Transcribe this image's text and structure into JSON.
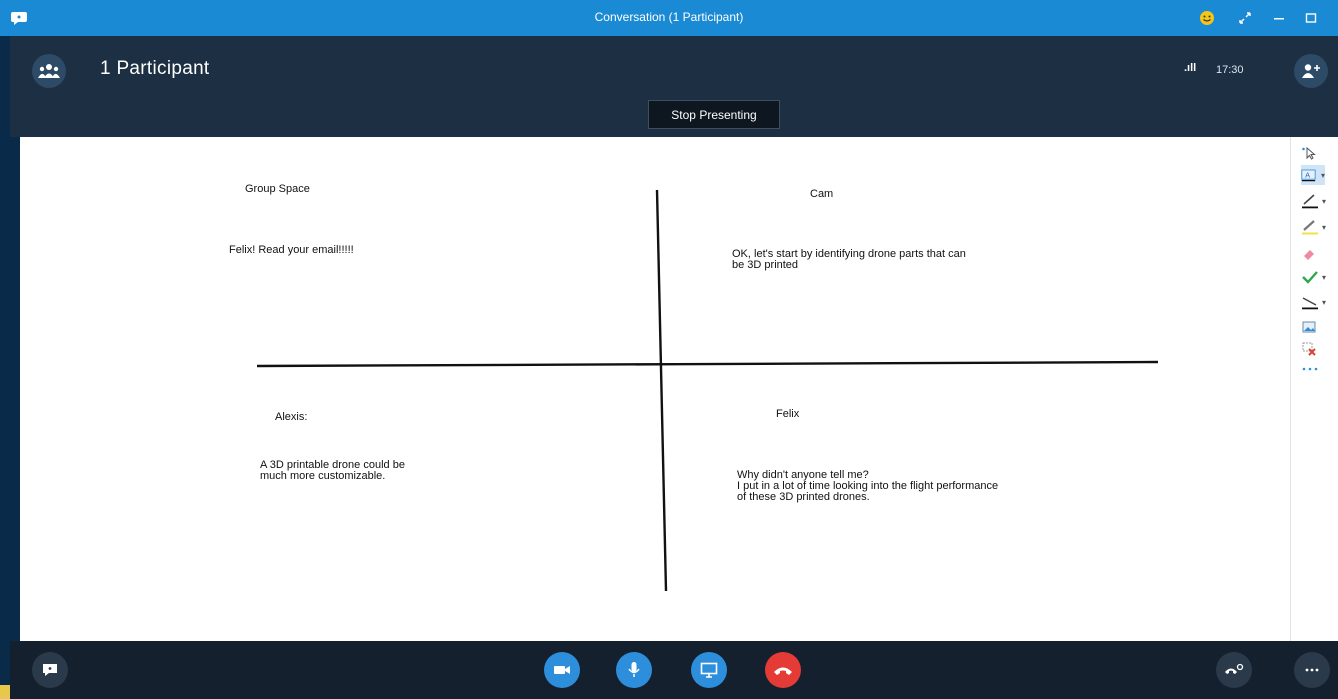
{
  "window": {
    "title": "Conversation (1 Participant)",
    "controls": [
      "emoji-icon",
      "expand-icon",
      "minimize-icon",
      "maximize-icon"
    ]
  },
  "header": {
    "participants_label": "1 Participant",
    "signal": ".ıll",
    "time": "17:30",
    "stop_presenting_label": "Stop Presenting"
  },
  "whiteboard": {
    "quadrants": {
      "top_left": {
        "heading": "Group Space",
        "body": "Felix!  Read your email!!!!!"
      },
      "top_right": {
        "heading": "Cam",
        "body": "OK, let's start by identifying drone parts that can\nbe 3D printed"
      },
      "bottom_left": {
        "heading": "Alexis:",
        "body": "A 3D printable drone could be\nmuch more customizable."
      },
      "bottom_right": {
        "heading": "Felix",
        "body": "Why didn't anyone tell me?\nI put in a lot of time looking into the flight performance\nof these 3D printed drones."
      }
    },
    "tools": [
      "pointer-icon",
      "text-tool-icon",
      "pen-icon",
      "highlighter-icon",
      "eraser-icon",
      "stamp-icon",
      "shape-icon",
      "insert-image-icon",
      "delete-selection-icon",
      "more-options-icon"
    ]
  },
  "bottom_bar": {
    "buttons": [
      "chat-icon",
      "video-icon",
      "microphone-icon",
      "present-screen-icon",
      "hang-up-icon",
      "call-controls-icon",
      "more-icon"
    ]
  },
  "colors": {
    "title_bar": "#1a8ad4",
    "header_bg": "#1c2f43",
    "bottom_bg": "#14202e",
    "button_blue": "#2d8fdc",
    "hangup_red": "#e43b36"
  }
}
